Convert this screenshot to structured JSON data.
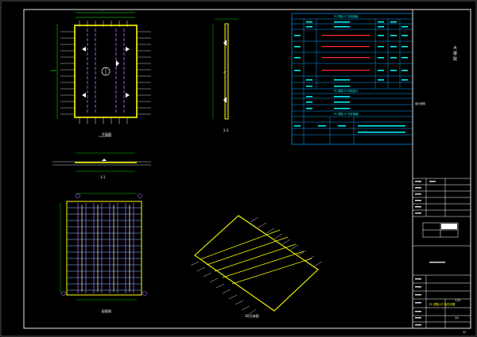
{
  "drawing": {
    "views": {
      "plan_label": "平面图",
      "side_label": "2-2",
      "section_label": "1-1",
      "rebar_label": "配筋图",
      "iso_label": "3D立体图"
    },
    "table": {
      "title1": "PC-预制-2T-材料明细",
      "title2": "PC-预制-2T-材料统计",
      "title3": "PC-预制-2T-吊件明细",
      "note_label": "设计说明"
    },
    "title_block": {
      "project_text": "大\n楼\n院",
      "drawing_title": "PC-预制-2T-构件详图",
      "scale_value": "1:25",
      "sheet_no": "2/2",
      "page_no": "42"
    },
    "colors": {
      "background": "#000000",
      "frame": "#ffffff",
      "outline": "#ffff00",
      "rebar": "#b060ff",
      "dimension": "#00ff00",
      "table_line": "#00a0ff",
      "table_text": "#00ffff",
      "highlight": "#ff3030"
    }
  }
}
